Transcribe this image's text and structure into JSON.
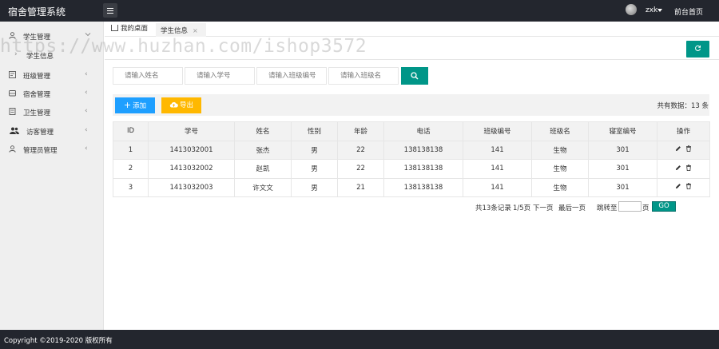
{
  "header": {
    "title": "宿舍管理系统",
    "user_name": "zxk",
    "front_link": "前台首页"
  },
  "sidebar": {
    "items": [
      {
        "label": "学生管理",
        "icon": "user-icon",
        "arrow": "chevron-down-icon"
      },
      {
        "label": "班级管理",
        "icon": "class-icon",
        "arrow": "chevron-left-icon"
      },
      {
        "label": "宿舍管理",
        "icon": "dorm-icon",
        "arrow": "chevron-left-icon"
      },
      {
        "label": "卫生管理",
        "icon": "hygiene-icon",
        "arrow": "chevron-left-icon"
      },
      {
        "label": "访客管理",
        "icon": "visitors-icon",
        "arrow": "chevron-left-icon"
      },
      {
        "label": "管理员管理",
        "icon": "admin-icon",
        "arrow": "chevron-left-icon"
      }
    ],
    "sub_items": [
      {
        "label": "学生信息"
      }
    ]
  },
  "tabs": [
    {
      "label": "我的桌面",
      "icon": "home-icon"
    },
    {
      "label": "学生信息",
      "close": "×"
    }
  ],
  "watermark": "https://www.huzhan.com/ishop3572",
  "search": {
    "name_placeholder": "请输入姓名",
    "id_placeholder": "请输入学号",
    "class_no_placeholder": "请输入班级编号",
    "class_name_placeholder": "请输入班级名"
  },
  "toolbar": {
    "add_label": "添加",
    "export_label": "导出",
    "total_label": "共有数据：13 条"
  },
  "table": {
    "headers": [
      "ID",
      "学号",
      "姓名",
      "性别",
      "年龄",
      "电话",
      "班级编号",
      "班级名",
      "寝室编号",
      "操作"
    ],
    "rows": [
      [
        "1",
        "1413032001",
        "张杰",
        "男",
        "22",
        "138138138",
        "141",
        "生物",
        "301"
      ],
      [
        "2",
        "1413032002",
        "赵凯",
        "男",
        "22",
        "138138138",
        "141",
        "生物",
        "301"
      ],
      [
        "3",
        "1413032003",
        "许文文",
        "男",
        "21",
        "138138138",
        "141",
        "生物",
        "301"
      ]
    ]
  },
  "pager": {
    "records": "共13条记录",
    "page": "1/5页",
    "next": "下一页",
    "last": "最后一页",
    "jump_to": "跳转至",
    "page_unit": "页",
    "go": "GO"
  },
  "footer": {
    "copyright": "Copyright ©2019-2020 版权所有"
  },
  "colors": {
    "header_bg": "#23262e",
    "accent": "#009688",
    "add_button": "#1e9fff",
    "export_button": "#ffb800"
  }
}
